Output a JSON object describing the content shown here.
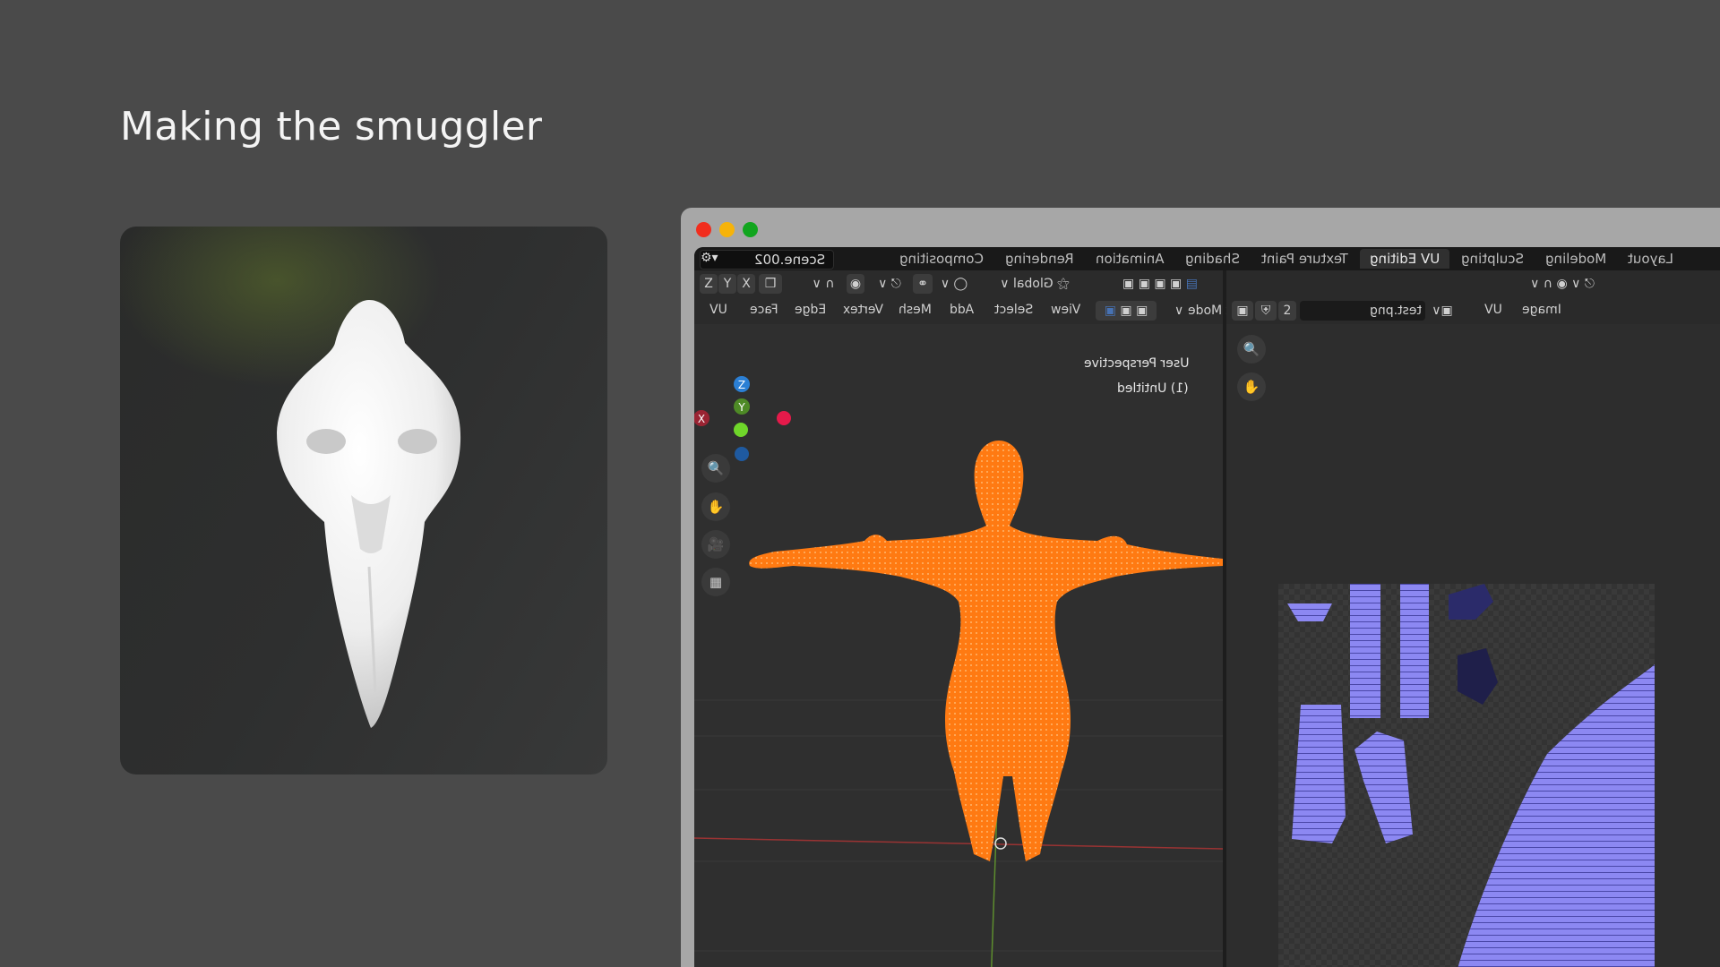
{
  "slide": {
    "title": "Making the smuggler"
  },
  "window": {
    "scene_name": "Scene.002",
    "workspace_tabs": [
      "Layout",
      "Modeling",
      "Sculpting",
      "UV Editing",
      "Texture Paint",
      "Shading",
      "Animation",
      "Rendering",
      "Compositing"
    ],
    "active_tab": "UV Editing",
    "viewport": {
      "orientation": "Global",
      "mode": "Edit Mode",
      "menus": [
        "View",
        "Select",
        "Add",
        "Mesh",
        "Vertex",
        "Edge",
        "Face",
        "UV"
      ],
      "axis_buttons": [
        "X",
        "Y",
        "Z"
      ],
      "overlay_label": "User Perspective",
      "object_label": "(1) Untitled",
      "gizmo_axes": [
        "X",
        "Y",
        "Z"
      ]
    },
    "uv_editor": {
      "menus": [
        "Image",
        "UV"
      ],
      "image_name": "test.png",
      "slot_number": "2"
    }
  }
}
